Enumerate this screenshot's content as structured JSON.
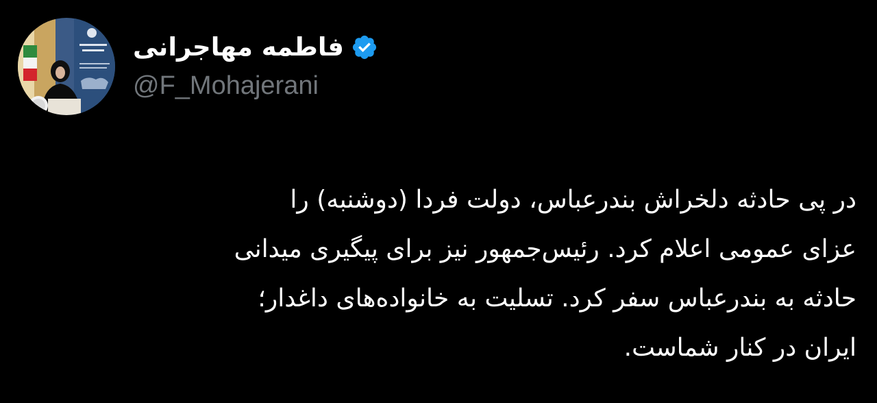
{
  "author": {
    "display_name": "فاطمه مهاجرانی",
    "handle": "@F_Mohajerani",
    "verified": true,
    "verified_icon": "verified-badge-icon",
    "avatar_icon": "profile-photo"
  },
  "tweet": {
    "text": "در پی حادثه دلخراش بندرعباس، دولت فردا (دوشنبه) را\nعزای عمومی اعلام کرد. رئیس‌جمهور نیز برای پیگیری میدانی\nحادثه به بندرعباس سفر کرد. تسلیت به خانواده‌های داغدار؛\nایران در کنار شماست."
  },
  "colors": {
    "background": "#000000",
    "text": "#ffffff",
    "handle": "#71767b",
    "verified": "#1d9bf0"
  }
}
